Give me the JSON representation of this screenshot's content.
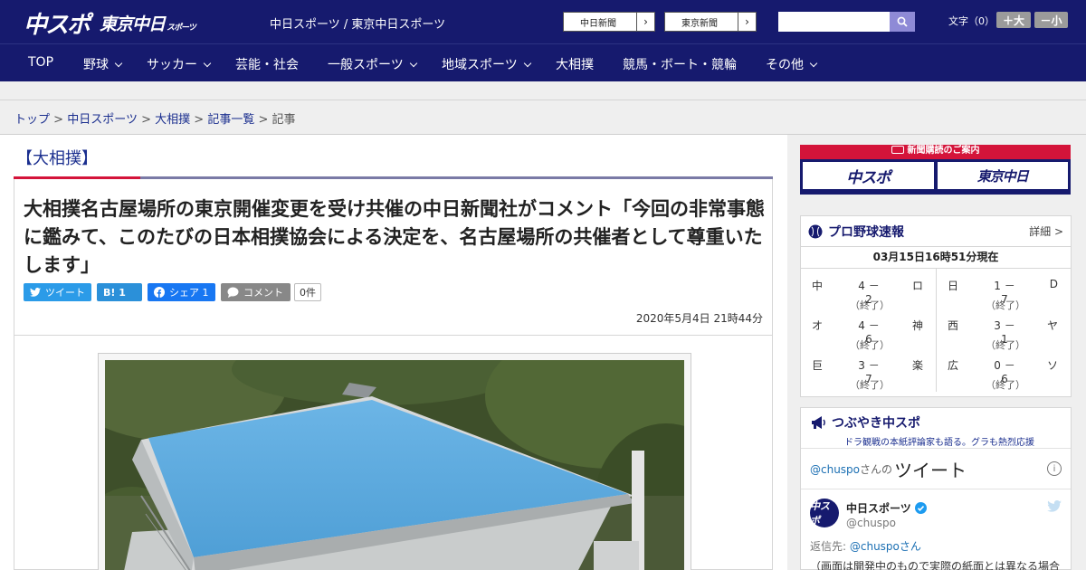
{
  "header": {
    "logo_chuspo": "中スポ",
    "logo_tokyo": "東京中日",
    "logo_tokyo_small": "スポーツ",
    "site_links": "中日スポーツ / 東京中日スポーツ",
    "ext_chunichi": "中日新聞",
    "ext_tokyo": "東京新聞",
    "fontsize_label": "文字（0）",
    "fontsize_up": "＋大",
    "fontsize_down": "－小"
  },
  "nav": [
    {
      "label": "TOP",
      "has_menu": false
    },
    {
      "label": "野球",
      "has_menu": true
    },
    {
      "label": "サッカー",
      "has_menu": true
    },
    {
      "label": "芸能・社会",
      "has_menu": false
    },
    {
      "label": "一般スポーツ",
      "has_menu": true
    },
    {
      "label": "地域スポーツ",
      "has_menu": true
    },
    {
      "label": "大相撲",
      "has_menu": false
    },
    {
      "label": "競馬・ボート・競輪",
      "has_menu": false
    },
    {
      "label": "その他",
      "has_menu": true
    }
  ],
  "breadcrumb": {
    "top": "トップ",
    "chuspo": "中日スポーツ",
    "sumo": "大相撲",
    "list": "記事一覧",
    "current": "記事",
    "sep": ">"
  },
  "article": {
    "category": "【大相撲】",
    "headline": "大相撲名古屋場所の東京開催変更を受け共催の中日新聞社がコメント「今回の非常事態に鑑みて、このたびの日本相撲協会による決定を、名古屋場所の共催者として尊重いたします」",
    "share_tweet": "ツイート",
    "share_hatena": "B! 1",
    "share_facebook": "シェア 1",
    "share_comment": "コメント",
    "comment_count": "0件",
    "date": "2020年5月4日 21時44分"
  },
  "sidebar": {
    "subscribe_head": "新聞購読のご案内",
    "subscribe_chuspo": "中スポ",
    "subscribe_tokyo": "東京中日",
    "score_title": "プロ野球速報",
    "score_more": "詳細 >",
    "score_time": "03月15日16時51分現在",
    "games_left": [
      {
        "t1": "中",
        "score": "4 － 2",
        "t2": "ロ",
        "status": "（終了）"
      },
      {
        "t1": "オ",
        "score": "4 － 6",
        "t2": "神",
        "status": "（終了）"
      },
      {
        "t1": "巨",
        "score": "3 － 7",
        "t2": "楽",
        "status": "（終了）"
      }
    ],
    "games_right": [
      {
        "t1": "日",
        "score": "1 － 7",
        "t2": "D",
        "status": "（終了）"
      },
      {
        "t1": "西",
        "score": "3 － 1",
        "t2": "ヤ",
        "status": "（終了）"
      },
      {
        "t1": "広",
        "score": "0 － 6",
        "t2": "ソ",
        "status": "（終了）"
      }
    ],
    "tw_title": "つぶやき中スポ",
    "tw_sub": "ドラ観戦の本紙評論家も語る。グラも熱烈応援",
    "tw_user": "@chuspo",
    "tw_user_suffix": "さんの",
    "tw_tweets_label": "ツイート",
    "tw_name": "中日スポーツ",
    "tw_handle": "@chuspo",
    "tw_reply_prefix": "返信先: ",
    "tw_reply_user": "@chuspoさん",
    "tw_text": "（画面は開発中のもので実際の紙面とは異なる場合"
  },
  "colors": {
    "brand_navy": "#161a6e",
    "accent_red": "#d4143a"
  }
}
